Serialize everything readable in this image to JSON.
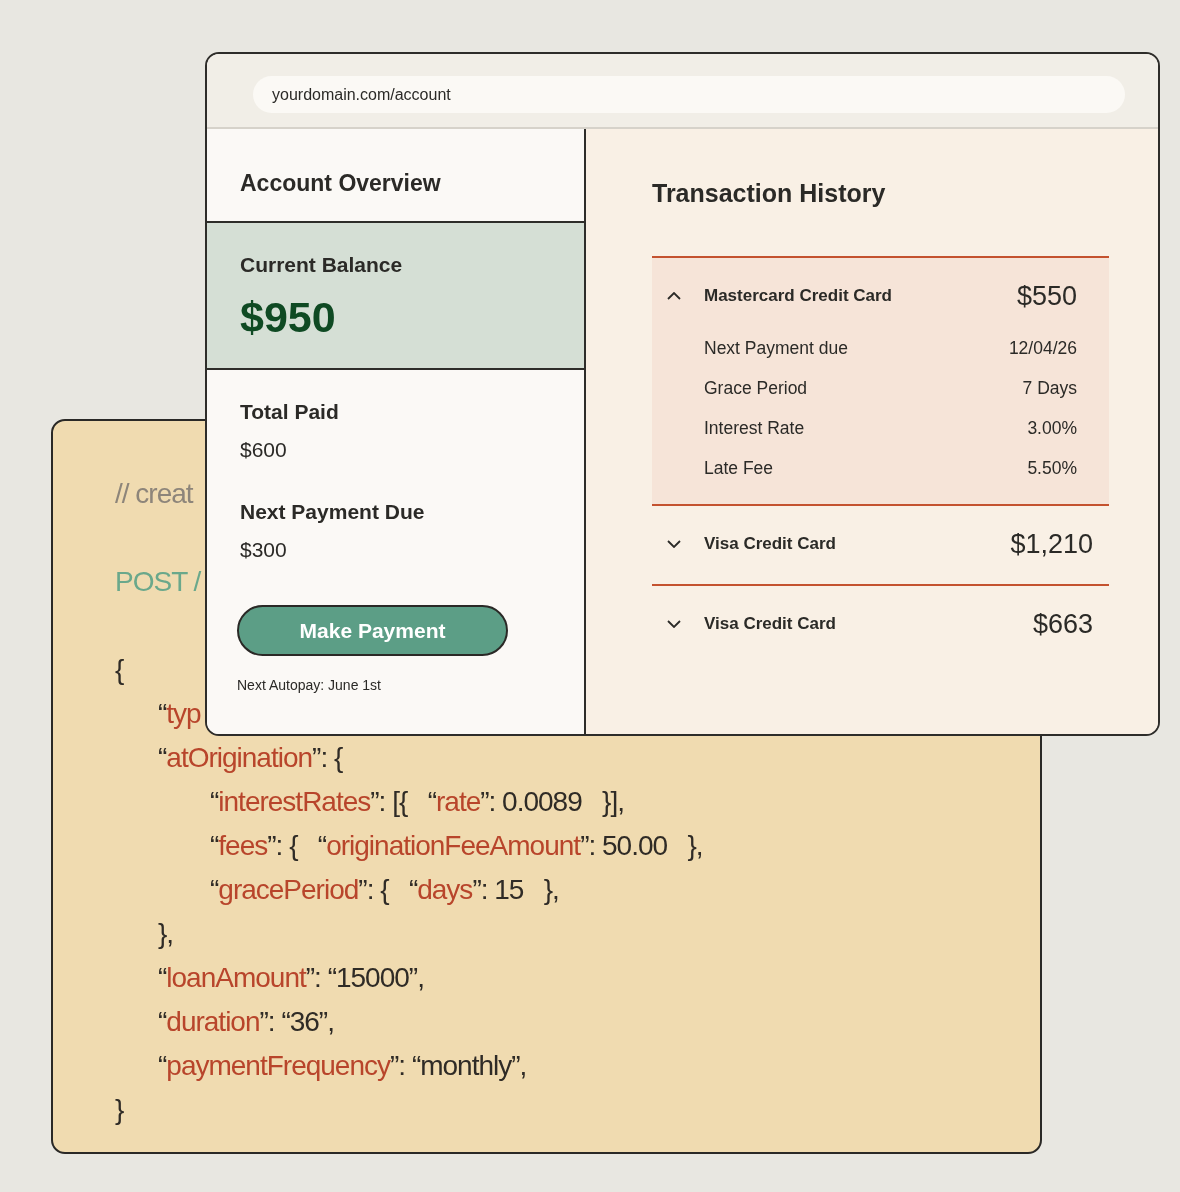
{
  "browser": {
    "url": "yourdomain.com/account"
  },
  "overview": {
    "title": "Account Overview",
    "balance": {
      "label": "Current Balance",
      "value": "$950"
    },
    "stats": [
      {
        "label": "Total Paid",
        "value": "$600"
      },
      {
        "label": "Next Payment Due",
        "value": "$300"
      }
    ],
    "button": "Make Payment",
    "note": "Next Autopay: June 1st"
  },
  "transactions": {
    "title": "Transaction History",
    "items": [
      {
        "name": "Mastercard Credit Card",
        "amount": "$550",
        "expanded": true,
        "details": [
          {
            "label": "Next Payment due",
            "value": "12/04/26"
          },
          {
            "label": "Grace Period",
            "value": "7 Days"
          },
          {
            "label": "Interest Rate",
            "value": "3.00%"
          },
          {
            "label": "Late Fee",
            "value": "5.50%"
          }
        ]
      },
      {
        "name": "Visa Credit Card",
        "amount": "$1,210",
        "expanded": false
      },
      {
        "name": "Visa Credit Card",
        "amount": "$663",
        "expanded": false
      }
    ]
  },
  "code": {
    "lines": [
      {
        "segments": [
          {
            "kind": "comment",
            "text": "// creat"
          }
        ]
      },
      {
        "segments": [
          {
            "kind": "method",
            "text": "POST /"
          }
        ]
      },
      {
        "segments": [
          {
            "kind": "text",
            "text": "{"
          }
        ],
        "children": [
          {
            "segments": [
              {
                "kind": "text",
                "text": "“"
              },
              {
                "kind": "key",
                "text": "typ"
              }
            ]
          },
          {
            "segments": [
              {
                "kind": "text",
                "text": "“"
              },
              {
                "kind": "key",
                "text": "atOrigination"
              },
              {
                "kind": "text",
                "text": "”: {"
              }
            ],
            "children": [
              {
                "segments": [
                  {
                    "kind": "text",
                    "text": "“"
                  },
                  {
                    "kind": "key",
                    "text": "interestRates"
                  },
                  {
                    "kind": "text",
                    "text": "”: [{   “"
                  },
                  {
                    "kind": "key",
                    "text": "rate"
                  },
                  {
                    "kind": "text",
                    "text": "”: 0.0089   }],"
                  }
                ]
              },
              {
                "segments": [
                  {
                    "kind": "text",
                    "text": "“"
                  },
                  {
                    "kind": "key",
                    "text": "fees"
                  },
                  {
                    "kind": "text",
                    "text": "”: {   “"
                  },
                  {
                    "kind": "key",
                    "text": "originationFeeAmount"
                  },
                  {
                    "kind": "text",
                    "text": "”: 50.00   },"
                  }
                ]
              },
              {
                "segments": [
                  {
                    "kind": "text",
                    "text": "“"
                  },
                  {
                    "kind": "key",
                    "text": "gracePeriod"
                  },
                  {
                    "kind": "text",
                    "text": "”: {   “"
                  },
                  {
                    "kind": "key",
                    "text": "days"
                  },
                  {
                    "kind": "text",
                    "text": "”: 15   },"
                  }
                ]
              }
            ]
          },
          {
            "segments": [
              {
                "kind": "text",
                "text": "},"
              }
            ]
          },
          {
            "segments": [
              {
                "kind": "text",
                "text": "“"
              },
              {
                "kind": "key",
                "text": "loanAmount"
              },
              {
                "kind": "text",
                "text": "”: “15000”,"
              }
            ]
          },
          {
            "segments": [
              {
                "kind": "text",
                "text": "“"
              },
              {
                "kind": "key",
                "text": "duration"
              },
              {
                "kind": "text",
                "text": "”: “36”,"
              }
            ]
          },
          {
            "segments": [
              {
                "kind": "text",
                "text": "“"
              },
              {
                "kind": "key",
                "text": "paymentFrequency"
              },
              {
                "kind": "text",
                "text": "”: “monthly”,"
              }
            ]
          }
        ]
      },
      {
        "segments": [
          {
            "kind": "text",
            "text": "}"
          }
        ]
      }
    ]
  }
}
